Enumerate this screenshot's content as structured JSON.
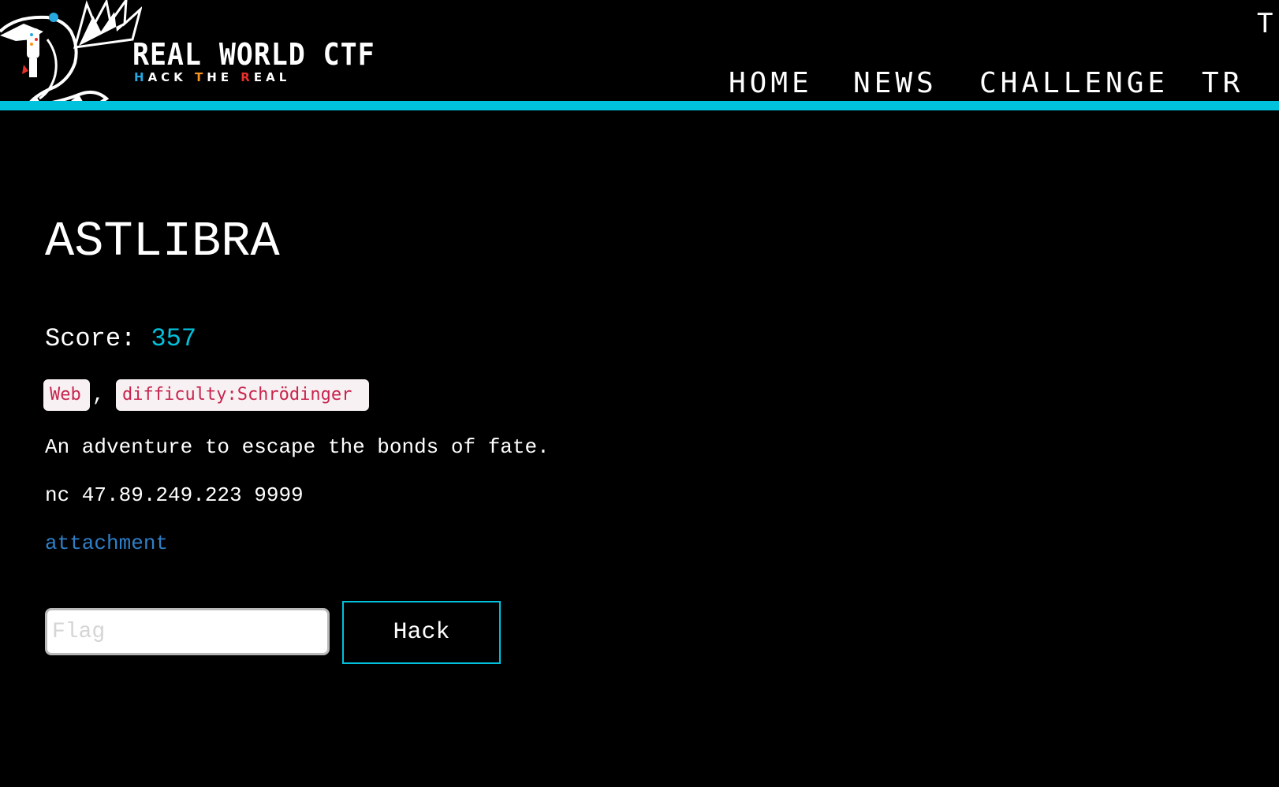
{
  "header": {
    "logo": {
      "title": "REAL WORLD CTF",
      "tagline_parts": [
        {
          "text": "H",
          "color": "#27a8e0"
        },
        {
          "text": "ACK ",
          "color": "#ffffff"
        },
        {
          "text": "T",
          "color": "#f7941d"
        },
        {
          "text": "HE ",
          "color": "#ffffff"
        },
        {
          "text": "R",
          "color": "#e8302a"
        },
        {
          "text": "EAL",
          "color": "#ffffff"
        }
      ],
      "icon": "dragon-logo-icon"
    },
    "nav": {
      "home": "HOME",
      "news": "NEWS",
      "challenge": "CHALLENGE",
      "truncated": "TR"
    },
    "top_right_text": "T",
    "accent_color": "#00c2dd"
  },
  "challenge": {
    "title": "ASTLIBRA",
    "score_label": "Score:",
    "score_value": "357",
    "tags": [
      "Web",
      "difficulty:Schrödinger"
    ],
    "tag_separator": ",",
    "description": "An adventure to escape the bonds of fate.",
    "connection": "nc 47.89.249.223 9999",
    "attachment_label": "attachment"
  },
  "form": {
    "flag_placeholder": "Flag",
    "flag_value": "",
    "submit_label": "Hack"
  }
}
